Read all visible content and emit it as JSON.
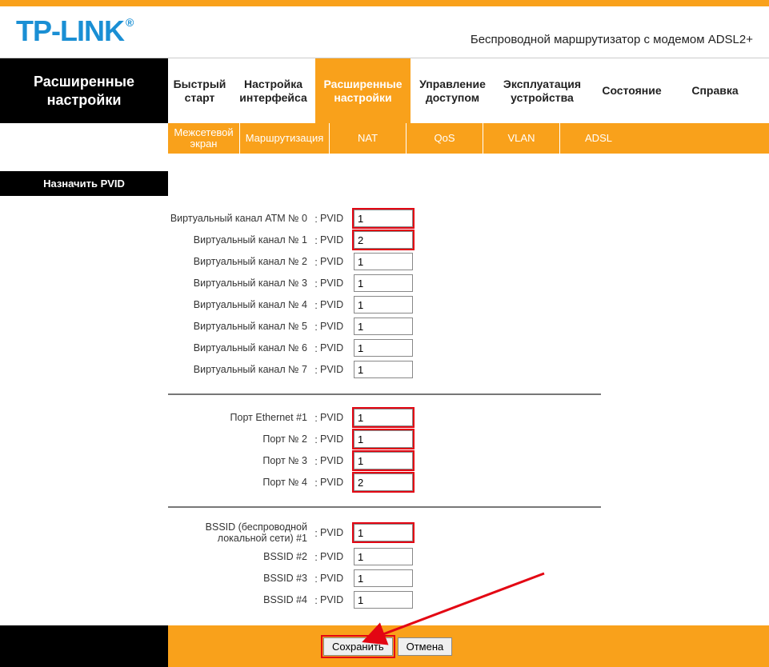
{
  "brand": "TP-LINK",
  "brand_reg": "®",
  "tagline": "Беспроводной маршрутизатор с модемом ADSL2+",
  "side_title": "Расширенные настройки",
  "main_tabs": [
    "Быстрый старт",
    "Настройка интерфейса",
    "Расширенные настройки",
    "Управление доступом",
    "Эксплуатация устройства",
    "Состояние",
    "Справка"
  ],
  "main_tab_active_index": 2,
  "sub_tabs": [
    "Межсетевой экран",
    "Маршрутизация",
    "NAT",
    "QoS",
    "VLAN",
    "ADSL"
  ],
  "section_title": "Назначить PVID",
  "pvid_label": "PVID",
  "groups": [
    {
      "rows": [
        {
          "label": "Виртуальный канал ATM № 0",
          "value": "1",
          "highlight": true
        },
        {
          "label": "Виртуальный канал № 1",
          "value": "2",
          "highlight": true
        },
        {
          "label": "Виртуальный канал № 2",
          "value": "1",
          "highlight": false
        },
        {
          "label": "Виртуальный канал № 3",
          "value": "1",
          "highlight": false
        },
        {
          "label": "Виртуальный канал № 4",
          "value": "1",
          "highlight": false
        },
        {
          "label": "Виртуальный канал № 5",
          "value": "1",
          "highlight": false
        },
        {
          "label": "Виртуальный канал № 6",
          "value": "1",
          "highlight": false
        },
        {
          "label": "Виртуальный канал № 7",
          "value": "1",
          "highlight": false
        }
      ]
    },
    {
      "rows": [
        {
          "label": "Порт Ethernet #1",
          "value": "1",
          "highlight": true
        },
        {
          "label": "Порт № 2",
          "value": "1",
          "highlight": true
        },
        {
          "label": "Порт № 3",
          "value": "1",
          "highlight": true
        },
        {
          "label": "Порт № 4",
          "value": "2",
          "highlight": true
        }
      ]
    },
    {
      "rows": [
        {
          "label": "BSSID (беспроводной локальной сети) #1",
          "value": "1",
          "highlight": true
        },
        {
          "label": "BSSID #2",
          "value": "1",
          "highlight": false
        },
        {
          "label": "BSSID #3",
          "value": "1",
          "highlight": false
        },
        {
          "label": "BSSID #4",
          "value": "1",
          "highlight": false
        }
      ]
    }
  ],
  "buttons": {
    "save": "Сохранить",
    "cancel": "Отмена"
  }
}
